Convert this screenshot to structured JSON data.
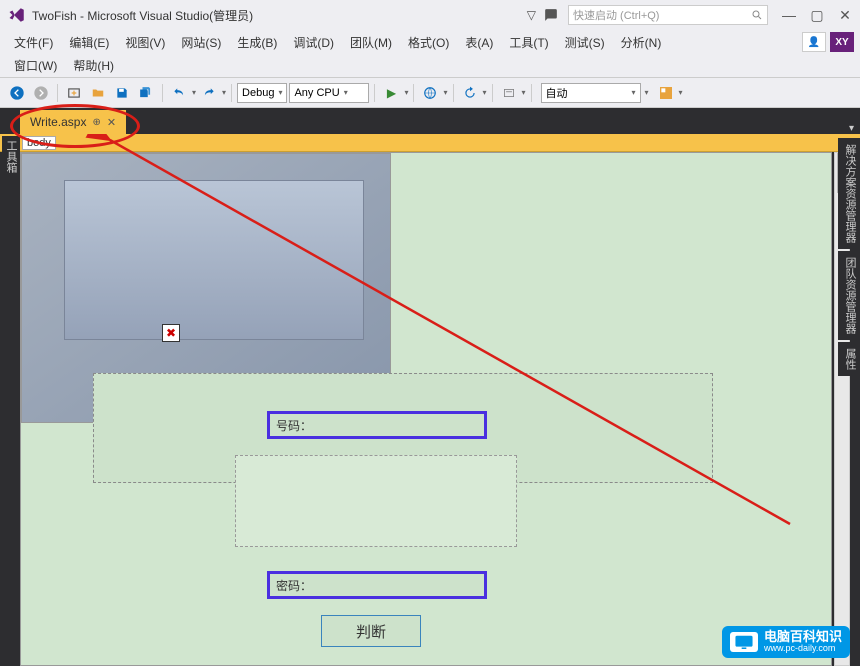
{
  "titlebar": {
    "app_title": "TwoFish - Microsoft Visual Studio(管理员)",
    "quick_launch_placeholder": "快速启动 (Ctrl+Q)"
  },
  "menus": {
    "row1": [
      {
        "label": "文件(F)"
      },
      {
        "label": "编辑(E)"
      },
      {
        "label": "视图(V)"
      },
      {
        "label": "网站(S)"
      },
      {
        "label": "生成(B)"
      },
      {
        "label": "调试(D)"
      },
      {
        "label": "团队(M)"
      },
      {
        "label": "格式(O)"
      },
      {
        "label": "表(A)"
      },
      {
        "label": "工具(T)"
      },
      {
        "label": "测试(S)"
      },
      {
        "label": "分析(N)"
      }
    ],
    "row2": [
      {
        "label": "窗口(W)"
      },
      {
        "label": "帮助(H)"
      }
    ],
    "xy_badge": "XY"
  },
  "toolbar": {
    "config_dropdown": "Debug",
    "platform_dropdown": "Any CPU",
    "auto_dropdown": "自动"
  },
  "tab": {
    "filename": "Write.aspx",
    "breadcrumb": "body"
  },
  "left_sidebar": {
    "label": "工具箱"
  },
  "right_panels": [
    {
      "label": "解决方案资源管理器"
    },
    {
      "label": "团队资源管理器"
    },
    {
      "label": "属性"
    }
  ],
  "designer": {
    "field1_label": "号码：",
    "field2_label": "密码：",
    "button_label": "判断"
  },
  "watermark": {
    "title": "电脑百科知识",
    "url": "www.pc-daily.com"
  }
}
